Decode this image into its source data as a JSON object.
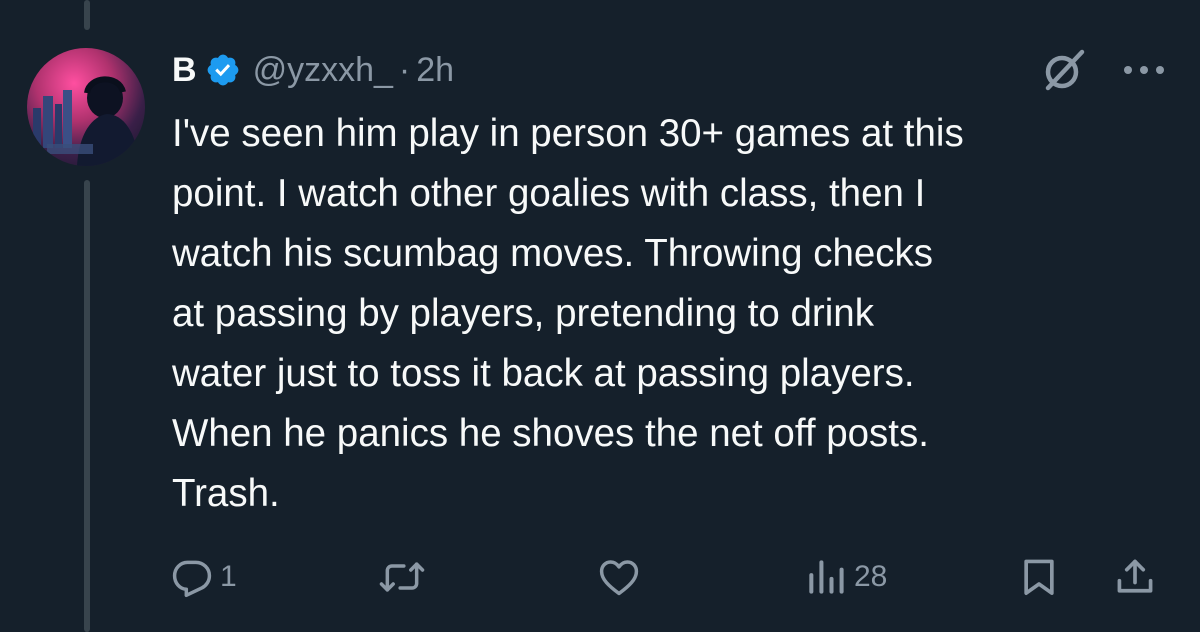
{
  "tweet": {
    "author_name": "B",
    "handle": "@yzxxh_",
    "separator": "·",
    "time": "2h",
    "verified": true,
    "text_lines": [
      "I've seen him play in person 30+ games at this",
      "point. I watch other goalies with class, then I",
      "watch his scumbag moves. Throwing checks",
      "at passing by players, pretending to drink",
      "water just to toss it back at passing players.",
      "When he panics he shoves the net off posts.",
      "Trash."
    ]
  },
  "actions": {
    "reply_count": "1",
    "retweet_count": "",
    "like_count": "",
    "views_count": "28"
  },
  "icons": {
    "verified": "verified-badge-icon",
    "grok": "grok-icon",
    "more": "more-options-icon",
    "reply": "reply-icon",
    "retweet": "retweet-icon",
    "like": "like-icon",
    "views": "views-icon",
    "bookmark": "bookmark-icon",
    "share": "share-icon"
  },
  "colors": {
    "background": "#15202b",
    "text_primary": "#f7f9f9",
    "text_secondary": "#8b98a5",
    "verified_blue": "#1d9bf0",
    "thread_line": "#38444d"
  }
}
